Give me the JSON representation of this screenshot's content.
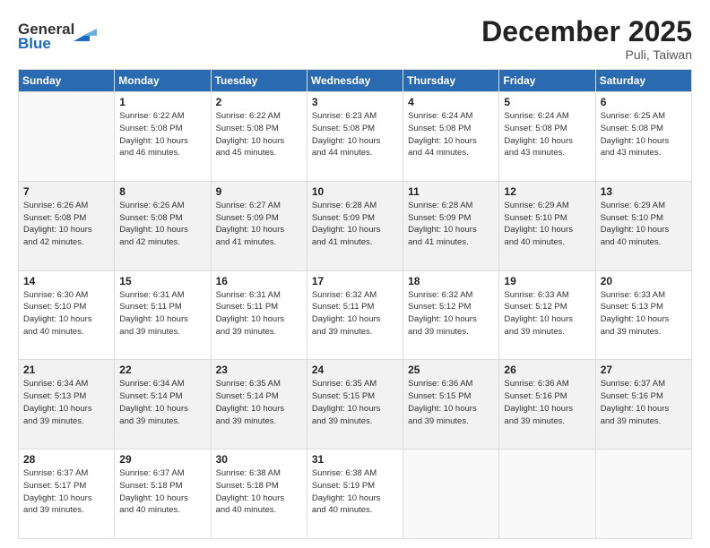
{
  "header": {
    "logo_line1": "General",
    "logo_line2": "Blue",
    "month": "December 2025",
    "location": "Puli, Taiwan"
  },
  "days_of_week": [
    "Sunday",
    "Monday",
    "Tuesday",
    "Wednesday",
    "Thursday",
    "Friday",
    "Saturday"
  ],
  "weeks": [
    [
      {
        "day": "",
        "info": ""
      },
      {
        "day": "1",
        "info": "Sunrise: 6:22 AM\nSunset: 5:08 PM\nDaylight: 10 hours\nand 46 minutes."
      },
      {
        "day": "2",
        "info": "Sunrise: 6:22 AM\nSunset: 5:08 PM\nDaylight: 10 hours\nand 45 minutes."
      },
      {
        "day": "3",
        "info": "Sunrise: 6:23 AM\nSunset: 5:08 PM\nDaylight: 10 hours\nand 44 minutes."
      },
      {
        "day": "4",
        "info": "Sunrise: 6:24 AM\nSunset: 5:08 PM\nDaylight: 10 hours\nand 44 minutes."
      },
      {
        "day": "5",
        "info": "Sunrise: 6:24 AM\nSunset: 5:08 PM\nDaylight: 10 hours\nand 43 minutes."
      },
      {
        "day": "6",
        "info": "Sunrise: 6:25 AM\nSunset: 5:08 PM\nDaylight: 10 hours\nand 43 minutes."
      }
    ],
    [
      {
        "day": "7",
        "info": "Sunrise: 6:26 AM\nSunset: 5:08 PM\nDaylight: 10 hours\nand 42 minutes."
      },
      {
        "day": "8",
        "info": "Sunrise: 6:26 AM\nSunset: 5:08 PM\nDaylight: 10 hours\nand 42 minutes."
      },
      {
        "day": "9",
        "info": "Sunrise: 6:27 AM\nSunset: 5:09 PM\nDaylight: 10 hours\nand 41 minutes."
      },
      {
        "day": "10",
        "info": "Sunrise: 6:28 AM\nSunset: 5:09 PM\nDaylight: 10 hours\nand 41 minutes."
      },
      {
        "day": "11",
        "info": "Sunrise: 6:28 AM\nSunset: 5:09 PM\nDaylight: 10 hours\nand 41 minutes."
      },
      {
        "day": "12",
        "info": "Sunrise: 6:29 AM\nSunset: 5:10 PM\nDaylight: 10 hours\nand 40 minutes."
      },
      {
        "day": "13",
        "info": "Sunrise: 6:29 AM\nSunset: 5:10 PM\nDaylight: 10 hours\nand 40 minutes."
      }
    ],
    [
      {
        "day": "14",
        "info": "Sunrise: 6:30 AM\nSunset: 5:10 PM\nDaylight: 10 hours\nand 40 minutes."
      },
      {
        "day": "15",
        "info": "Sunrise: 6:31 AM\nSunset: 5:11 PM\nDaylight: 10 hours\nand 39 minutes."
      },
      {
        "day": "16",
        "info": "Sunrise: 6:31 AM\nSunset: 5:11 PM\nDaylight: 10 hours\nand 39 minutes."
      },
      {
        "day": "17",
        "info": "Sunrise: 6:32 AM\nSunset: 5:11 PM\nDaylight: 10 hours\nand 39 minutes."
      },
      {
        "day": "18",
        "info": "Sunrise: 6:32 AM\nSunset: 5:12 PM\nDaylight: 10 hours\nand 39 minutes."
      },
      {
        "day": "19",
        "info": "Sunrise: 6:33 AM\nSunset: 5:12 PM\nDaylight: 10 hours\nand 39 minutes."
      },
      {
        "day": "20",
        "info": "Sunrise: 6:33 AM\nSunset: 5:13 PM\nDaylight: 10 hours\nand 39 minutes."
      }
    ],
    [
      {
        "day": "21",
        "info": "Sunrise: 6:34 AM\nSunset: 5:13 PM\nDaylight: 10 hours\nand 39 minutes."
      },
      {
        "day": "22",
        "info": "Sunrise: 6:34 AM\nSunset: 5:14 PM\nDaylight: 10 hours\nand 39 minutes."
      },
      {
        "day": "23",
        "info": "Sunrise: 6:35 AM\nSunset: 5:14 PM\nDaylight: 10 hours\nand 39 minutes."
      },
      {
        "day": "24",
        "info": "Sunrise: 6:35 AM\nSunset: 5:15 PM\nDaylight: 10 hours\nand 39 minutes."
      },
      {
        "day": "25",
        "info": "Sunrise: 6:36 AM\nSunset: 5:15 PM\nDaylight: 10 hours\nand 39 minutes."
      },
      {
        "day": "26",
        "info": "Sunrise: 6:36 AM\nSunset: 5:16 PM\nDaylight: 10 hours\nand 39 minutes."
      },
      {
        "day": "27",
        "info": "Sunrise: 6:37 AM\nSunset: 5:16 PM\nDaylight: 10 hours\nand 39 minutes."
      }
    ],
    [
      {
        "day": "28",
        "info": "Sunrise: 6:37 AM\nSunset: 5:17 PM\nDaylight: 10 hours\nand 39 minutes."
      },
      {
        "day": "29",
        "info": "Sunrise: 6:37 AM\nSunset: 5:18 PM\nDaylight: 10 hours\nand 40 minutes."
      },
      {
        "day": "30",
        "info": "Sunrise: 6:38 AM\nSunset: 5:18 PM\nDaylight: 10 hours\nand 40 minutes."
      },
      {
        "day": "31",
        "info": "Sunrise: 6:38 AM\nSunset: 5:19 PM\nDaylight: 10 hours\nand 40 minutes."
      },
      {
        "day": "",
        "info": ""
      },
      {
        "day": "",
        "info": ""
      },
      {
        "day": "",
        "info": ""
      }
    ]
  ]
}
